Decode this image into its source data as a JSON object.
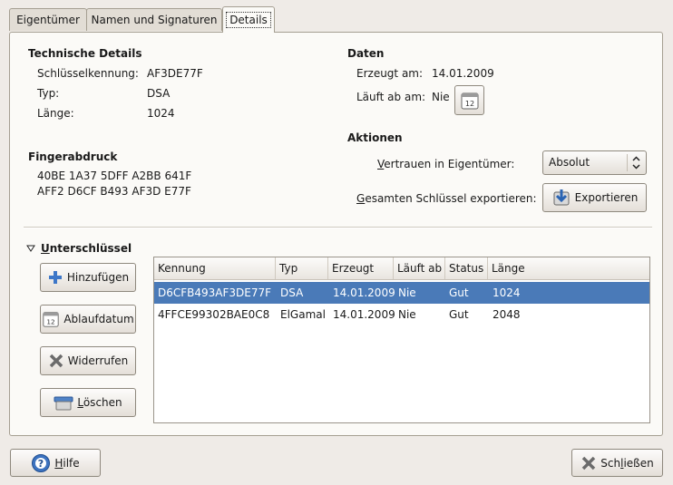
{
  "tabs": [
    {
      "label": "Eigentümer"
    },
    {
      "label": "Namen und Signaturen"
    },
    {
      "label": "Details"
    }
  ],
  "technical": {
    "heading": "Technische Details",
    "key_id_label": "Schlüsselkennung:",
    "key_id_value": "AF3DE77F",
    "type_label": "Typ:",
    "type_value": "DSA",
    "length_label": "Länge:",
    "length_value": "1024"
  },
  "fingerprint": {
    "heading": "Fingerabdruck",
    "line1": "40BE 1A37 5DFF A2BB 641F",
    "line2": "AFF2 D6CF B493 AF3D E77F"
  },
  "dates": {
    "heading": "Daten",
    "created_label": "Erzeugt am:",
    "created_value": "14.01.2009",
    "expires_label": "Läuft ab am:",
    "expires_value": "Nie",
    "calendar_icon_text": "12"
  },
  "actions": {
    "heading": "Aktionen",
    "trust_label_mn": "V",
    "trust_label_rest": "ertrauen in Eigentümer:",
    "trust_value": "Absolut",
    "export_label_mn": "G",
    "export_label_rest": "esamten Schlüssel exportieren:",
    "export_button": "Exportieren"
  },
  "subkeys": {
    "heading_mn": "U",
    "heading_rest": "nterschlüssel",
    "buttons": {
      "add": "Hinzufügen",
      "expiry": "Ablaufdatum",
      "revoke": "Widerrufen",
      "delete_mn": "L",
      "delete_rest": "öschen"
    },
    "columns": [
      "Kennung",
      "Typ",
      "Erzeugt",
      "Läuft ab",
      "Status",
      "Länge"
    ],
    "rows": [
      {
        "id": "D6CFB493AF3DE77F",
        "type": "DSA",
        "created": "14.01.2009",
        "expires": "Nie",
        "status": "Gut",
        "length": "1024",
        "selected": true
      },
      {
        "id": "4FFCE99302BAE0C8",
        "type": "ElGamal",
        "created": "14.01.2009",
        "expires": "Nie",
        "status": "Gut",
        "length": "2048",
        "selected": false
      }
    ]
  },
  "footer": {
    "help_mn": "H",
    "help_rest": "ilfe",
    "close_pre": "Sch",
    "close_mn": "l",
    "close_rest": "ießen"
  },
  "colors": {
    "selection": "#4a7ab8",
    "window_bg": "#efebe7",
    "panel_bg": "#fbfaf7"
  },
  "icons": {
    "trust_dropdown": "spin-arrows-icon",
    "export": "export-icon",
    "add": "plus-icon",
    "expiry": "calendar-icon",
    "revoke": "x-icon",
    "delete": "trash-icon",
    "help": "help-icon",
    "close": "close-icon",
    "expander": "triangle-down-icon"
  }
}
